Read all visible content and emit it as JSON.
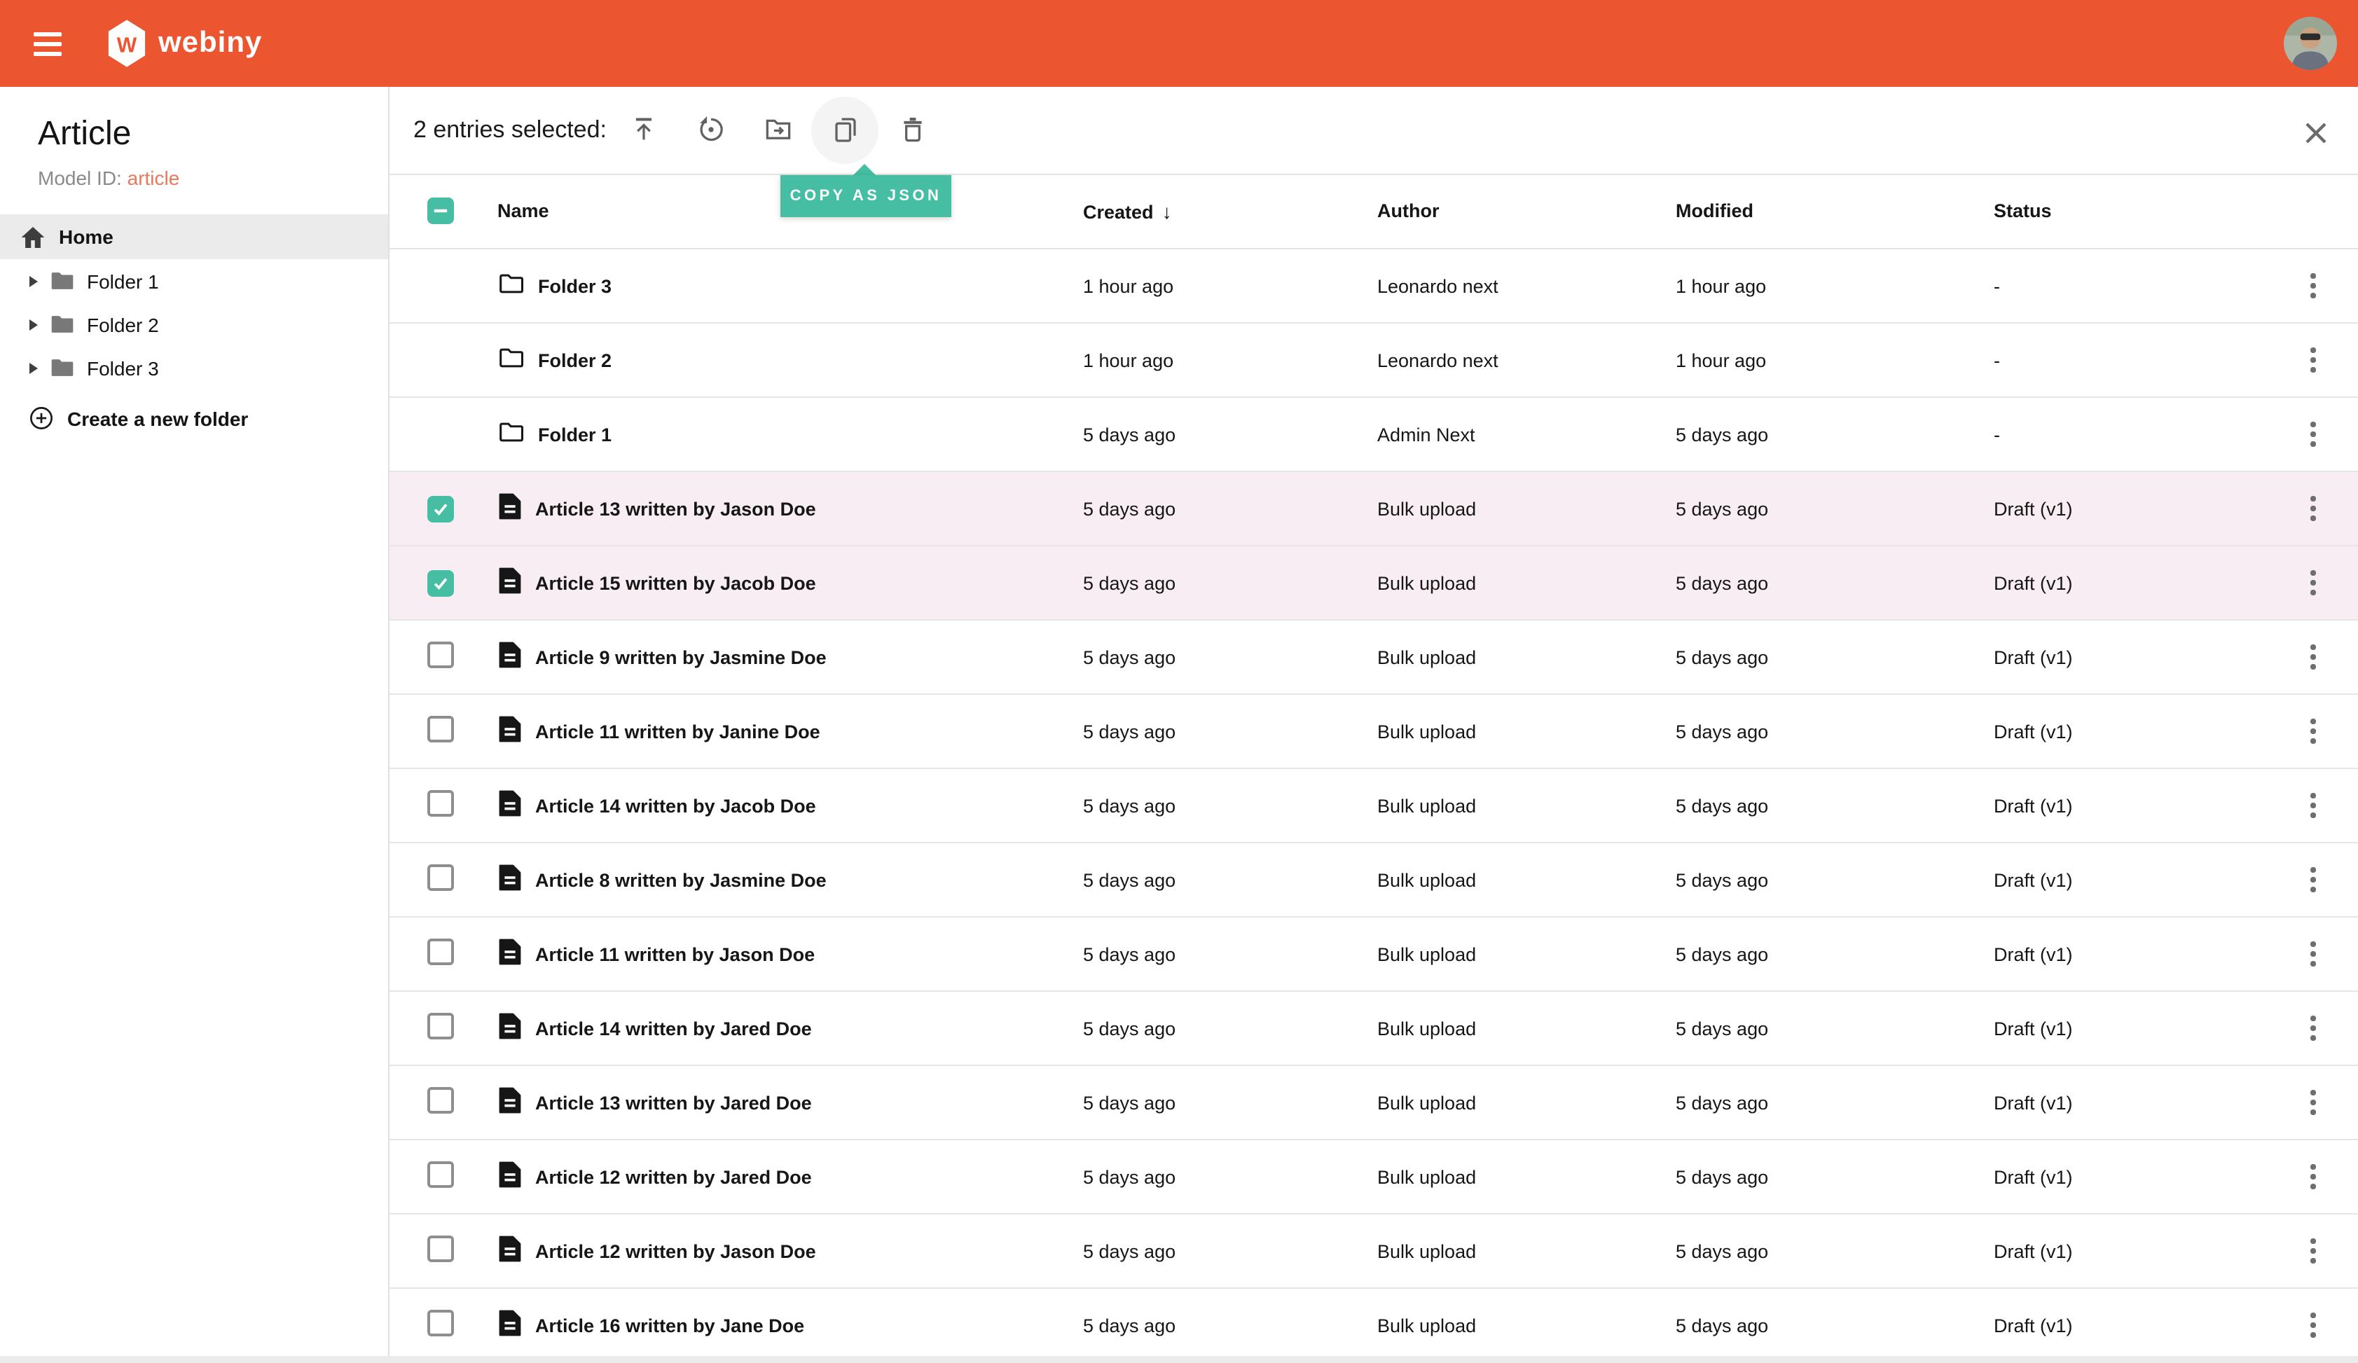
{
  "topbar": {
    "logo_text": "webiny"
  },
  "sidebar": {
    "title": "Article",
    "model_id_label": "Model ID:",
    "model_id_value": "article",
    "home_label": "Home",
    "folders": [
      {
        "label": "Folder 1"
      },
      {
        "label": "Folder 2"
      },
      {
        "label": "Folder 3"
      }
    ],
    "create_folder_label": "Create a new folder"
  },
  "selection_bar": {
    "selected_text": "2 entries selected:",
    "actions": [
      {
        "name": "publish"
      },
      {
        "name": "unpublish"
      },
      {
        "name": "move-to-folder"
      },
      {
        "name": "copy-as-json",
        "active": true
      },
      {
        "name": "delete"
      }
    ],
    "tooltip": "COPY AS JSON"
  },
  "table": {
    "columns": [
      "Name",
      "Created",
      "Author",
      "Modified",
      "Status"
    ],
    "sorted_column": "Created",
    "sort_direction": "desc",
    "sort_indicator": "↓",
    "header_checkbox_state": "indeterminate",
    "rows": [
      {
        "type": "folder",
        "name": "Folder 3",
        "created": "1 hour ago",
        "author": "Leonardo next",
        "modified": "1 hour ago",
        "status": "-",
        "selected": false
      },
      {
        "type": "folder",
        "name": "Folder 2",
        "created": "1 hour ago",
        "author": "Leonardo next",
        "modified": "1 hour ago",
        "status": "-",
        "selected": false
      },
      {
        "type": "folder",
        "name": "Folder 1",
        "created": "5 days ago",
        "author": "Admin Next",
        "modified": "5 days ago",
        "status": "-",
        "selected": false
      },
      {
        "type": "article",
        "name": "Article 13 written by Jason Doe",
        "created": "5 days ago",
        "author": "Bulk upload",
        "modified": "5 days ago",
        "status": "Draft (v1)",
        "selected": true
      },
      {
        "type": "article",
        "name": "Article 15 written by Jacob Doe",
        "created": "5 days ago",
        "author": "Bulk upload",
        "modified": "5 days ago",
        "status": "Draft (v1)",
        "selected": true
      },
      {
        "type": "article",
        "name": "Article 9 written by Jasmine Doe",
        "created": "5 days ago",
        "author": "Bulk upload",
        "modified": "5 days ago",
        "status": "Draft (v1)",
        "selected": false
      },
      {
        "type": "article",
        "name": "Article 11 written by Janine Doe",
        "created": "5 days ago",
        "author": "Bulk upload",
        "modified": "5 days ago",
        "status": "Draft (v1)",
        "selected": false
      },
      {
        "type": "article",
        "name": "Article 14 written by Jacob Doe",
        "created": "5 days ago",
        "author": "Bulk upload",
        "modified": "5 days ago",
        "status": "Draft (v1)",
        "selected": false
      },
      {
        "type": "article",
        "name": "Article 8 written by Jasmine Doe",
        "created": "5 days ago",
        "author": "Bulk upload",
        "modified": "5 days ago",
        "status": "Draft (v1)",
        "selected": false
      },
      {
        "type": "article",
        "name": "Article 11 written by Jason Doe",
        "created": "5 days ago",
        "author": "Bulk upload",
        "modified": "5 days ago",
        "status": "Draft (v1)",
        "selected": false
      },
      {
        "type": "article",
        "name": "Article 14 written by Jared Doe",
        "created": "5 days ago",
        "author": "Bulk upload",
        "modified": "5 days ago",
        "status": "Draft (v1)",
        "selected": false
      },
      {
        "type": "article",
        "name": "Article 13 written by Jared Doe",
        "created": "5 days ago",
        "author": "Bulk upload",
        "modified": "5 days ago",
        "status": "Draft (v1)",
        "selected": false
      },
      {
        "type": "article",
        "name": "Article 12 written by Jared Doe",
        "created": "5 days ago",
        "author": "Bulk upload",
        "modified": "5 days ago",
        "status": "Draft (v1)",
        "selected": false
      },
      {
        "type": "article",
        "name": "Article 12 written by Jason Doe",
        "created": "5 days ago",
        "author": "Bulk upload",
        "modified": "5 days ago",
        "status": "Draft (v1)",
        "selected": false
      },
      {
        "type": "article",
        "name": "Article 16 written by Jane Doe",
        "created": "5 days ago",
        "author": "Bulk upload",
        "modified": "5 days ago",
        "status": "Draft (v1)",
        "selected": false
      }
    ]
  },
  "colors": {
    "topbar_orange": "#eb5630",
    "accent_teal": "#45bea3",
    "selected_row_pink": "#f8edf2",
    "model_link_orange": "#e87a5c",
    "annotation_red": "#e9493d"
  }
}
